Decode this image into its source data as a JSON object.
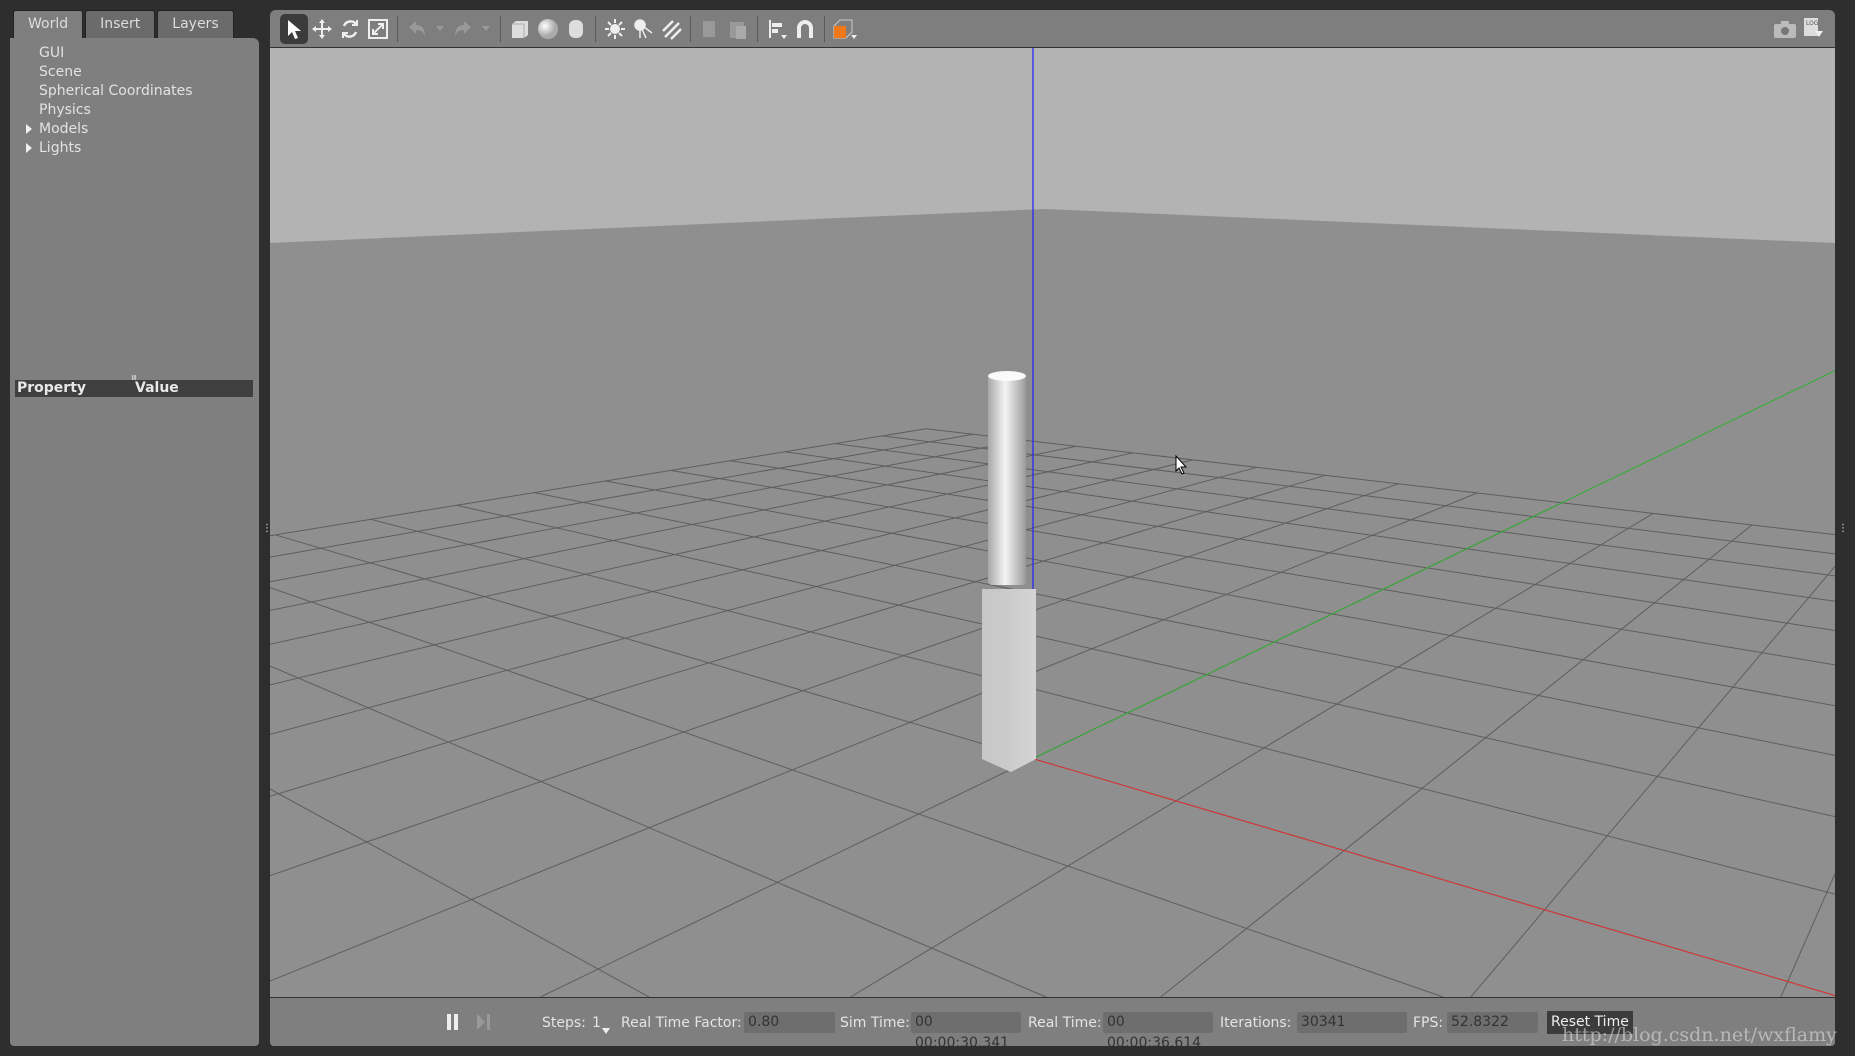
{
  "tabs": [
    "World",
    "Insert",
    "Layers"
  ],
  "tree": [
    {
      "label": "GUI",
      "expandable": false
    },
    {
      "label": "Scene",
      "expandable": false
    },
    {
      "label": "Spherical Coordinates",
      "expandable": false
    },
    {
      "label": "Physics",
      "expandable": false
    },
    {
      "label": "Models",
      "expandable": true
    },
    {
      "label": "Lights",
      "expandable": true
    }
  ],
  "props": {
    "property": "Property",
    "value": "Value"
  },
  "toolbar": {
    "icons": [
      "select-arrow",
      "translate",
      "rotate",
      "scale",
      "undo",
      "redo",
      "box",
      "sphere",
      "cylinder",
      "point-light",
      "spot-light",
      "directional-light",
      "copy",
      "paste",
      "align",
      "snap",
      "view-angle"
    ],
    "right_icons": [
      "screenshot",
      "log"
    ]
  },
  "bottom": {
    "steps_label": "Steps:",
    "steps_value": "1",
    "rtf_label": "Real Time Factor:",
    "rtf_value": "0.80",
    "sim_label": "Sim Time:",
    "sim_value": "00 00:00:30.341",
    "real_label": "Real Time:",
    "real_value": "00 00:00:36.614",
    "iter_label": "Iterations:",
    "iter_value": "30341",
    "fps_label": "FPS:",
    "fps_value": "52.8322",
    "reset_label": "Reset Time"
  },
  "watermark": "http://blog.csdn.net/wxflamy",
  "colors": {
    "x_axis": "#e03030",
    "y_axis": "#30b030",
    "z_axis": "#2020ff",
    "sky": "#b3b3b3",
    "ground": "#8f8f8f",
    "accent": "#f07818"
  }
}
